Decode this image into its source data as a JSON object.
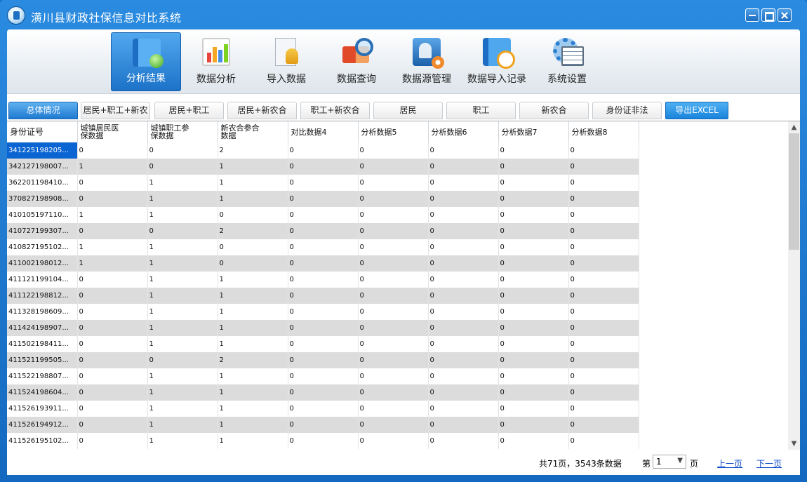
{
  "window": {
    "title": "潢川县财政社保信息对比系统"
  },
  "toolbar": {
    "items": [
      {
        "label": "分析结果",
        "icon": "analysis-result-icon",
        "active": true
      },
      {
        "label": "数据分析",
        "icon": "bar-chart-icon",
        "active": false
      },
      {
        "label": "导入数据",
        "icon": "import-user-icon",
        "active": false
      },
      {
        "label": "数据查询",
        "icon": "book-search-icon",
        "active": false
      },
      {
        "label": "数据源管理",
        "icon": "datasource-icon",
        "active": false
      },
      {
        "label": "数据导入记录",
        "icon": "import-record-icon",
        "active": false
      },
      {
        "label": "系统设置",
        "icon": "settings-gear-icon",
        "active": false
      }
    ]
  },
  "tabs": [
    {
      "label": "总体情况",
      "active": true
    },
    {
      "label": "居民+职工+新农"
    },
    {
      "label": "居民+职工"
    },
    {
      "label": "居民+新农合"
    },
    {
      "label": "职工+新农合"
    },
    {
      "label": "居民"
    },
    {
      "label": "职工"
    },
    {
      "label": "新农合"
    },
    {
      "label": "身份证非法"
    }
  ],
  "export_label": "导出EXCEL",
  "grid": {
    "columns": [
      [
        "身份证号"
      ],
      [
        "城镇居民医",
        "保数据"
      ],
      [
        "城镇职工参",
        "保数据"
      ],
      [
        "新农合参合",
        "数据"
      ],
      [
        "对比数据4"
      ],
      [
        "分析数据5"
      ],
      [
        "分析数据6"
      ],
      [
        "分析数据7"
      ],
      [
        "分析数据8"
      ]
    ],
    "rows": [
      [
        "341225198205...",
        "0",
        "0",
        "2",
        "0",
        "0",
        "0",
        "0",
        "0"
      ],
      [
        "342127198007...",
        "1",
        "0",
        "1",
        "0",
        "0",
        "0",
        "0",
        "0"
      ],
      [
        "362201198410...",
        "0",
        "1",
        "1",
        "0",
        "0",
        "0",
        "0",
        "0"
      ],
      [
        "370827198908...",
        "0",
        "1",
        "1",
        "0",
        "0",
        "0",
        "0",
        "0"
      ],
      [
        "410105197110...",
        "1",
        "1",
        "0",
        "0",
        "0",
        "0",
        "0",
        "0"
      ],
      [
        "410727199307...",
        "0",
        "0",
        "2",
        "0",
        "0",
        "0",
        "0",
        "0"
      ],
      [
        "410827195102...",
        "1",
        "1",
        "0",
        "0",
        "0",
        "0",
        "0",
        "0"
      ],
      [
        "411002198012...",
        "1",
        "1",
        "0",
        "0",
        "0",
        "0",
        "0",
        "0"
      ],
      [
        "411121199104...",
        "0",
        "1",
        "1",
        "0",
        "0",
        "0",
        "0",
        "0"
      ],
      [
        "411122198812...",
        "0",
        "1",
        "1",
        "0",
        "0",
        "0",
        "0",
        "0"
      ],
      [
        "411328198609...",
        "0",
        "1",
        "1",
        "0",
        "0",
        "0",
        "0",
        "0"
      ],
      [
        "411424198907...",
        "0",
        "1",
        "1",
        "0",
        "0",
        "0",
        "0",
        "0"
      ],
      [
        "411502198411...",
        "0",
        "1",
        "1",
        "0",
        "0",
        "0",
        "0",
        "0"
      ],
      [
        "411521199505...",
        "0",
        "0",
        "2",
        "0",
        "0",
        "0",
        "0",
        "0"
      ],
      [
        "411522198807...",
        "0",
        "1",
        "1",
        "0",
        "0",
        "0",
        "0",
        "0"
      ],
      [
        "411524198604...",
        "0",
        "1",
        "1",
        "0",
        "0",
        "0",
        "0",
        "0"
      ],
      [
        "411526193911...",
        "0",
        "1",
        "1",
        "0",
        "0",
        "0",
        "0",
        "0"
      ],
      [
        "411526194912...",
        "0",
        "1",
        "1",
        "0",
        "0",
        "0",
        "0",
        "0"
      ],
      [
        "411526195102...",
        "0",
        "1",
        "1",
        "0",
        "0",
        "0",
        "0",
        "0"
      ]
    ]
  },
  "footer": {
    "summary": "共71页，3543条数据",
    "page_prefix": "第",
    "page_value": "1",
    "page_suffix": "页",
    "prev": "上一页",
    "next": "下一页"
  },
  "colors": {
    "accent": "#1976c9",
    "selected_cell": "#0a64d2",
    "alt_row": "#dcdcdc",
    "link": "#0645c8"
  }
}
